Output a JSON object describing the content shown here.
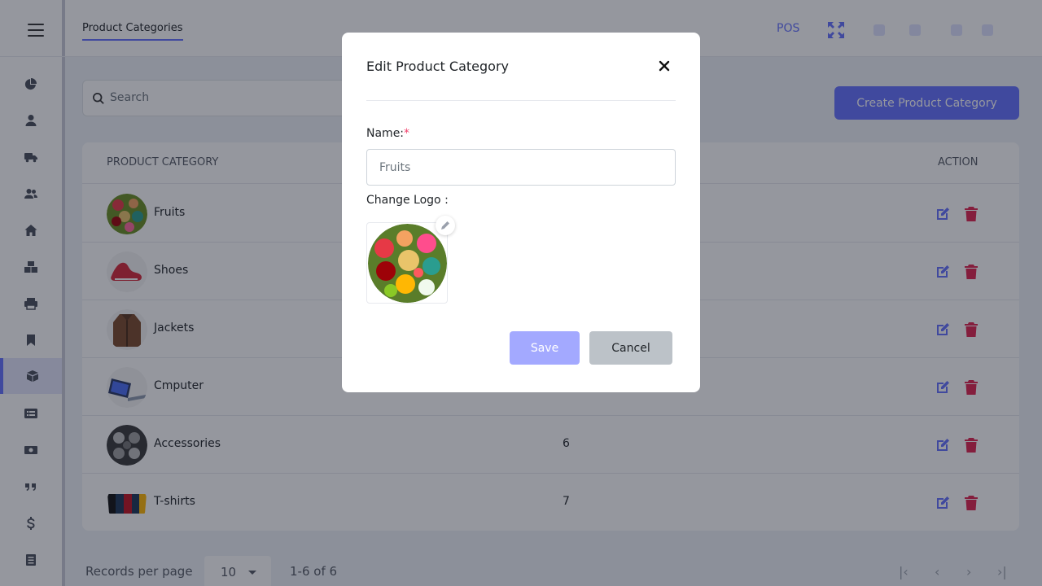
{
  "header": {
    "tab_label": "Product Categories",
    "pos_label": "POS"
  },
  "search": {
    "placeholder": "Search"
  },
  "create_button": "Create Product Category",
  "table": {
    "columns": [
      "PRODUCT CATEGORY",
      "ACTION"
    ],
    "rows": [
      {
        "name": "Fruits",
        "count": ""
      },
      {
        "name": "Shoes",
        "count": ""
      },
      {
        "name": "Jackets",
        "count": ""
      },
      {
        "name": "Cmputer",
        "count": ""
      },
      {
        "name": "Accessories",
        "count": "6"
      },
      {
        "name": "T-shirts",
        "count": "7"
      }
    ]
  },
  "footer": {
    "records_label": "Records per page",
    "per_page": "10",
    "range": "1-6 of 6"
  },
  "modal": {
    "title": "Edit Product Category",
    "name_label": "Name:",
    "required_mark": "*",
    "name_value": "Fruits",
    "logo_label": "Change Logo :",
    "save_label": "Save",
    "cancel_label": "Cancel"
  },
  "colors": {
    "accent": "#6571ff",
    "danger": "#f1416c",
    "delete_icon": "#e0244f"
  },
  "icons": {
    "sidebar": [
      "chart-pie-icon",
      "user-icon",
      "truck-icon",
      "users-icon",
      "home-icon",
      "boxes-icon",
      "print-icon",
      "bookmark-icon",
      "box-open-icon",
      "list-alt-icon",
      "money-bill-icon",
      "quote-icon",
      "dollar-icon",
      "file-icon"
    ]
  }
}
